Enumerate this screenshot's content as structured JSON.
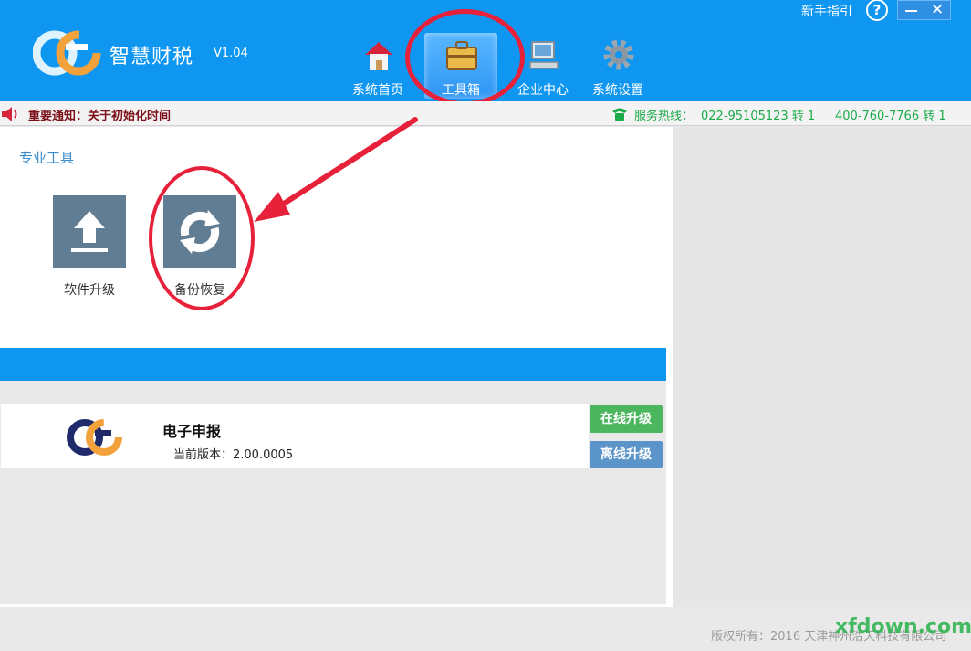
{
  "app": {
    "title": "智慧财税",
    "version": "V1.04",
    "guide_label": "新手指引",
    "help_label": "?",
    "close_label": "✕"
  },
  "nav": {
    "items": [
      {
        "label": "系统首页",
        "icon": "home-icon"
      },
      {
        "label": "工具箱",
        "icon": "toolbox-icon"
      },
      {
        "label": "企业中心",
        "icon": "computer-icon"
      },
      {
        "label": "系统设置",
        "icon": "gear-icon"
      }
    ],
    "active": "工具箱"
  },
  "notice": {
    "text": "重要通知：关于初始化时间",
    "hotline_label": "服务热线：",
    "hotline_1": "022-95105123 转 1",
    "hotline_2": "400-760-7766 转 1"
  },
  "tools": {
    "section_title": "专业工具",
    "items": [
      {
        "label": "软件升级",
        "icon": "upload-icon"
      },
      {
        "label": "备份恢复",
        "icon": "refresh-icon"
      }
    ]
  },
  "product": {
    "name": "电子申报",
    "version": "当前版本：2.00.0005",
    "online_upgrade_label": "在线升级",
    "offline_upgrade_label": "离线升级"
  },
  "footer": {
    "copyright": "版权所有：2016 天津神州浩天科技有限公司",
    "watermark": "xfdown.com"
  },
  "colors": {
    "header_blue": "#0f96f0",
    "tile_gray": "#607d94",
    "hotline_green": "#1cab4a",
    "annotation_red": "#e8213a"
  }
}
